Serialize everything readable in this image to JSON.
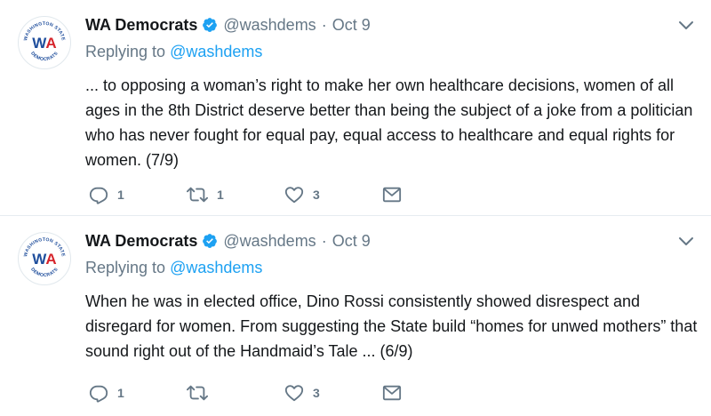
{
  "tweets": [
    {
      "author_name": "WA Democrats",
      "handle": "@washdems",
      "separator": "·",
      "date": "Oct 9",
      "replying_prefix": "Replying to",
      "replying_to": "@washdems",
      "text": "... to opposing a woman’s right to make her own healthcare decisions, women of all ages in the 8th District deserve better than being the subject of a joke from a politician who has never fought for equal pay, equal access to healthcare and equal rights for women. (7/9)",
      "reply_count": "1",
      "retweet_count": "1",
      "like_count": "3",
      "avatar_text": "WA",
      "avatar_top_text": "WASHINGTON STATE",
      "avatar_bottom_text": "DEMOCRATS"
    },
    {
      "author_name": "WA Democrats",
      "handle": "@washdems",
      "separator": "·",
      "date": "Oct 9",
      "replying_prefix": "Replying to",
      "replying_to": "@washdems",
      "text": "When he was in elected office, Dino Rossi consistently showed disrespect and disregard for women.  From suggesting the State build “homes for unwed mothers” that sound right out of the Handmaid’s Tale ... (6/9)",
      "reply_count": "1",
      "retweet_count": "",
      "like_count": "3",
      "avatar_text": "WA",
      "avatar_top_text": "WASHINGTON STATE",
      "avatar_bottom_text": "DEMOCRATS"
    }
  ],
  "colors": {
    "brand_blue": "#1da1f2",
    "avatar_blue": "#1f4e9c",
    "avatar_red": "#d6252c",
    "muted": "#657786"
  },
  "icons": {
    "verified": "verified-badge-icon",
    "caret": "chevron-down-icon",
    "reply": "reply-bubble-icon",
    "retweet": "retweet-icon",
    "like": "heart-icon",
    "dm": "envelope-icon"
  }
}
